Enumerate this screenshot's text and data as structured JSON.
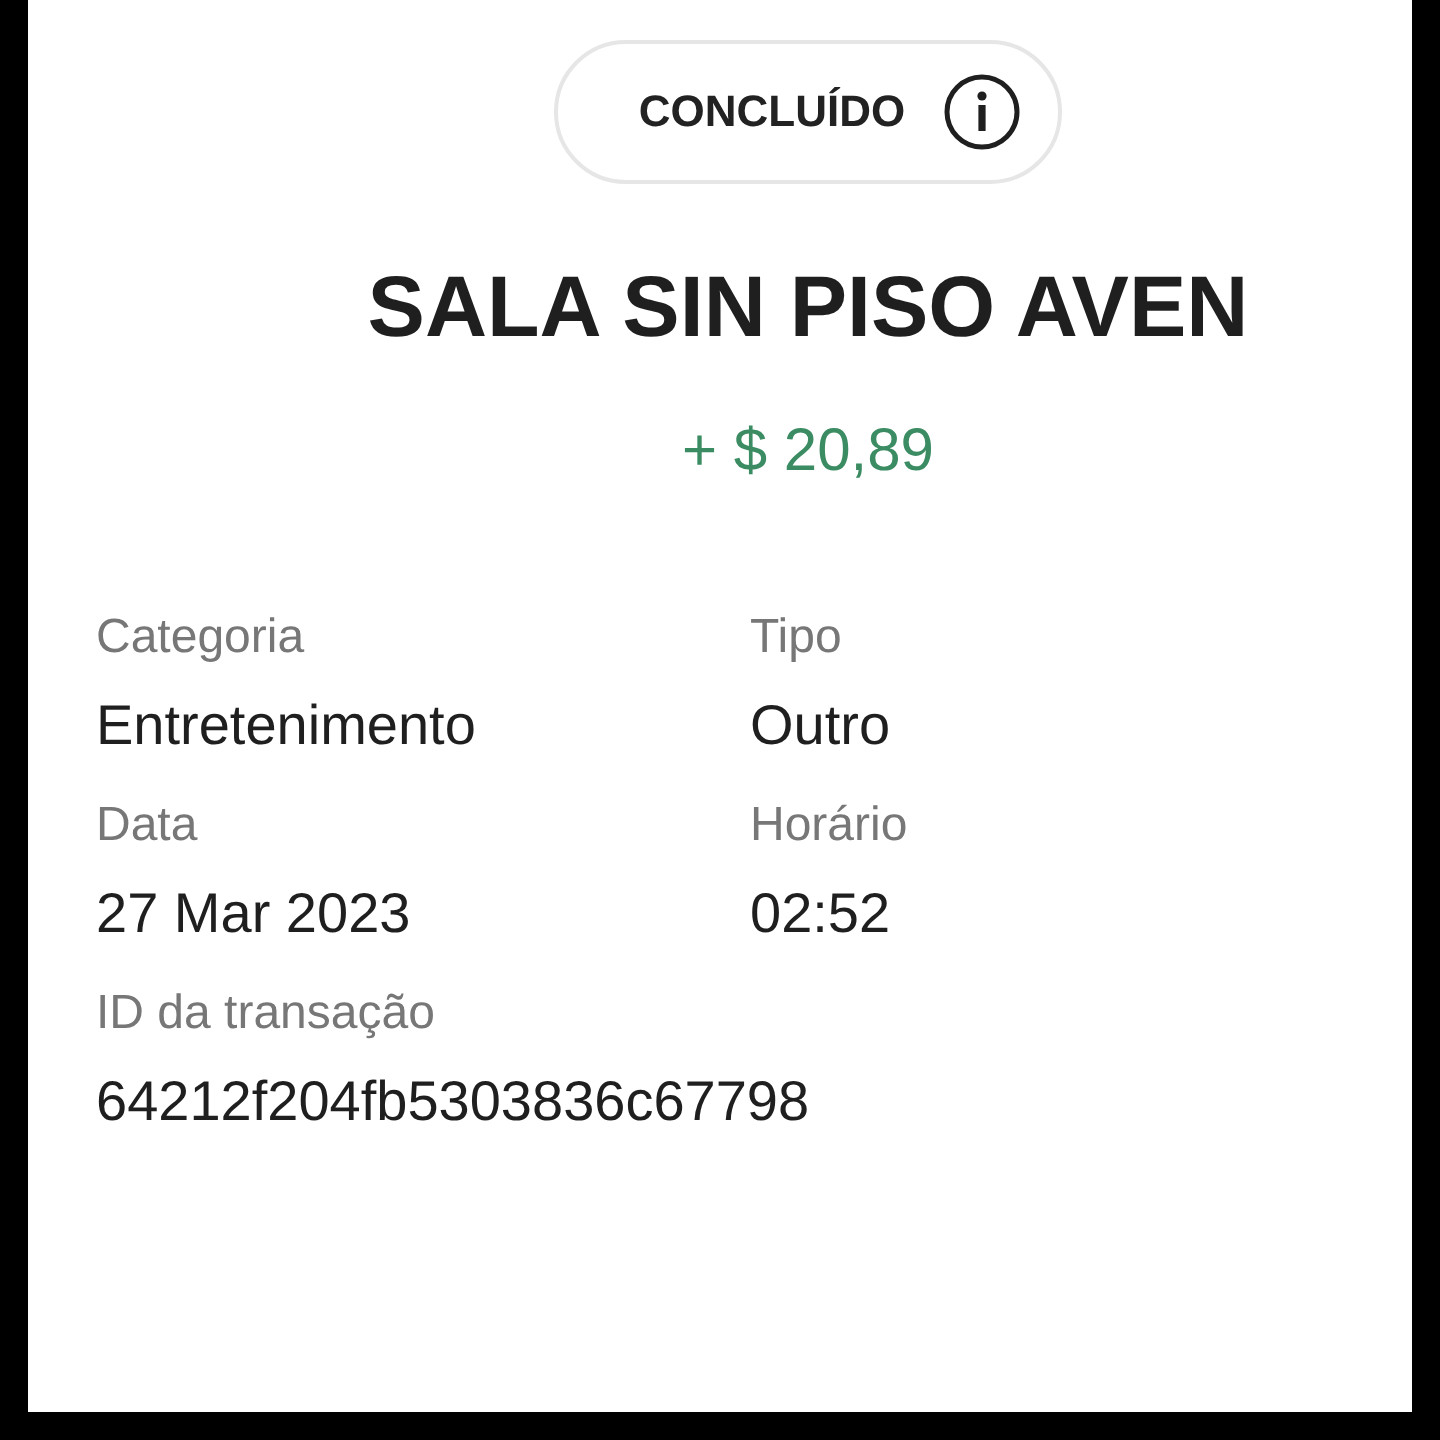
{
  "status": {
    "label": "CONCLUÍDO"
  },
  "title": "SALA SIN PISO AVEN",
  "amount": "+ $ 20,89",
  "details": [
    {
      "label": "Categoria",
      "value": "Entretenimento"
    },
    {
      "label": "Tipo",
      "value": "Outro"
    },
    {
      "label": "Data",
      "value": "27 Mar 2023"
    },
    {
      "label": "Horário",
      "value": "02:52"
    },
    {
      "label": "ID da transação",
      "value": "64212f204fb5303836c67798"
    }
  ]
}
